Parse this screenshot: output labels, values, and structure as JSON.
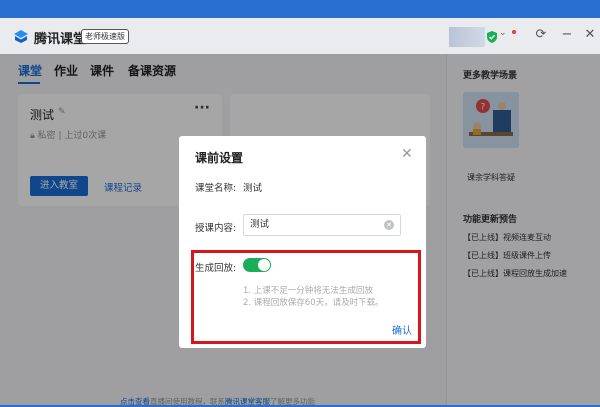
{
  "titlebar": {
    "app_title": "腾讯课堂",
    "badge": "老师极速版"
  },
  "tabs": [
    {
      "label": "课堂",
      "active": true
    },
    {
      "label": "作业"
    },
    {
      "label": "课件"
    },
    {
      "label": "备课资源"
    }
  ],
  "class_card": {
    "title": "测试",
    "meta": "私密 | 上过0次课",
    "enter_button": "进入教室",
    "record_link": "课程记录"
  },
  "bottom_note": {
    "link1": "点击查看",
    "text1": "直播间使用教程，联系",
    "link2": "腾讯课堂客服",
    "text2": "了解更多功能"
  },
  "sidebar": {
    "heading1": "更多教学场景",
    "scene_caption": "课余学科答疑",
    "heading2": "功能更新预告",
    "items": [
      "【已上线】视频连麦互动",
      "【已上线】班级课件上传",
      "【已上线】课程回放生成加速"
    ]
  },
  "dialog": {
    "title": "课前设置",
    "class_name_label": "课堂名称:",
    "class_name_value": "测试",
    "content_label": "授课内容:",
    "content_value": "测试",
    "replay_label": "生成回放:",
    "replay_on": true,
    "note1": "1. 上课不足一分钟将无法生成回放",
    "note2": "2. 课程回放保存60天，请及时下载。",
    "confirm": "确认"
  },
  "colors": {
    "accent": "#1a6ed8",
    "toggle_on": "#1aad5a",
    "highlight": "#d8151b"
  }
}
